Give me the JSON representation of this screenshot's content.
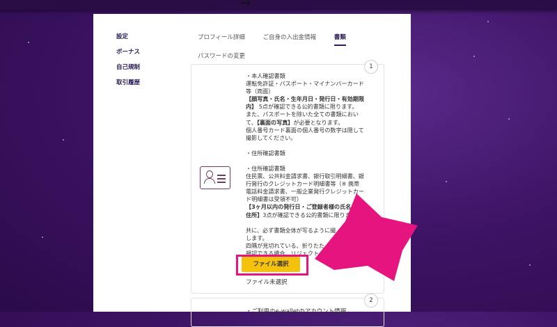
{
  "topbar": {
    "arrow_glyph": "→"
  },
  "sidebar": {
    "items": [
      {
        "label": "設定"
      },
      {
        "label": "ボーナス"
      },
      {
        "label": "自己規制"
      },
      {
        "label": "取引履歴"
      }
    ]
  },
  "tabs": [
    {
      "label": "プロフィール詳細"
    },
    {
      "label": "ご自身の入出金情報"
    },
    {
      "label": "書類",
      "active": true
    },
    {
      "label": "パスワードの変更"
    }
  ],
  "card1": {
    "number": "1",
    "icon": "id-card-icon",
    "lines": {
      "l1": "・本人確認書類",
      "l2": "運転免許証・パスポート・マイナンバーカード",
      "l3": "等（両面）",
      "l4": "【顔写真・氏名・生年月日・発行日・有効期限",
      "l5a": "内】",
      "l5b": " 5点が確認できる公的書類に限ります。",
      "l6": "また、パスポートを除いた全ての書類におい",
      "l7a": "て、",
      "l7b": "【裏面の写真】",
      "l7c": "が必要となります。",
      "l8": "個人番号カード裏面の個人番号の数字は隠して",
      "l9": "撮影してください。",
      "l10": "・住所確認書類",
      "l11": "・住所確認書類",
      "l12": "住民票、公共料金請求書、銀行取引明細書、銀",
      "l13": "行発行のクレジットカード明細書等（※ 携帯",
      "l14": "電話料金請求書、一般企業発行クレジットカー",
      "l15": "ド明細書は受領不可）",
      "l16": "【3ヶ月以内の発行日・ご登録者様の氏名・現",
      "l17a": "住所】",
      "l17b": "3点が確認できる公的書類に限りま",
      "l18": "共に、必ず書類全体が写るように撮",
      "l19": "します。",
      "l20": "四隅が見切れている、折りたた",
      "l21": "視認できる場合、リジェクト"
    },
    "file_button": "ファイル選択",
    "no_file": "ファイル未選択"
  },
  "card2": {
    "number": "2",
    "text": "・ご利用のe-walletのアカウント情報"
  },
  "colors": {
    "highlight": "#e6147e",
    "button": "#f4c20d",
    "brand": "#2b1a55"
  }
}
